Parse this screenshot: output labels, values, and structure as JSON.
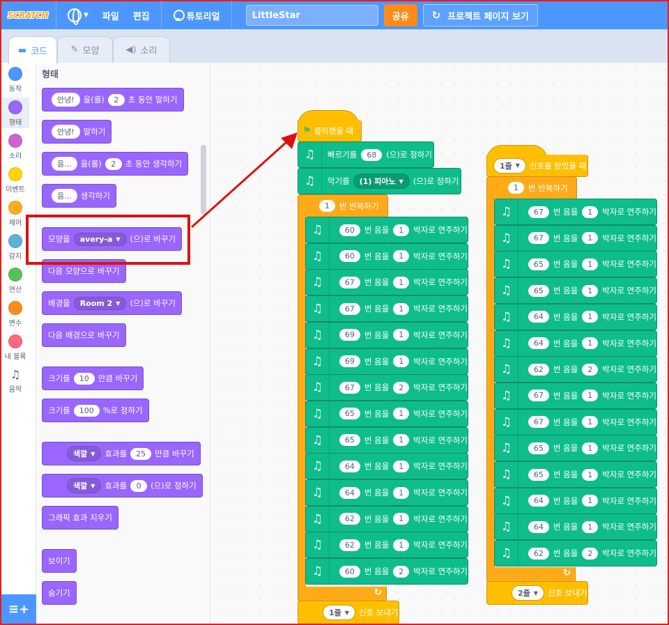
{
  "menu": {
    "logo": "SCRATCH",
    "file": "파일",
    "edit": "편집",
    "tutorials": "튜토리얼",
    "project_title": "LittleStar",
    "share": "공유",
    "see_project_page": "프로젝트 페이지 보기"
  },
  "tabs": {
    "code": "코드",
    "costumes": "모양",
    "sounds": "소리"
  },
  "categories": [
    {
      "label": "동작",
      "color": "#4c97ff"
    },
    {
      "label": "형태",
      "color": "#9966ff"
    },
    {
      "label": "소리",
      "color": "#cf63cf"
    },
    {
      "label": "이벤트",
      "color": "#ffd500"
    },
    {
      "label": "제어",
      "color": "#ffab19"
    },
    {
      "label": "감지",
      "color": "#5cb1d6"
    },
    {
      "label": "연산",
      "color": "#59c059"
    },
    {
      "label": "변수",
      "color": "#ff8c1a"
    },
    {
      "label": "내 블록",
      "color": "#ff6680"
    },
    {
      "label": "음악",
      "color": ""
    }
  ],
  "palette": {
    "heading": "형태",
    "say_for": {
      "a": "안녕!",
      "b": "을(를)",
      "c": "2",
      "d": "초 동안 말하기"
    },
    "say": {
      "a": "안녕!",
      "b": "말하기"
    },
    "think_for": {
      "a": "음...",
      "b": "을(를)",
      "c": "2",
      "d": "초 동안 생각하기"
    },
    "think": {
      "a": "음...",
      "b": "생각하기"
    },
    "switch_costume": {
      "a": "모양을",
      "b": "avery-a",
      "c": "(으)로 바꾸기"
    },
    "next_costume": "다음 모양으로 바꾸기",
    "switch_backdrop": {
      "a": "배경을",
      "b": "Room 2",
      "c": "(으)로 바꾸기"
    },
    "next_backdrop": "다음 배경으로 바꾸기",
    "change_size": {
      "a": "크기를",
      "b": "10",
      "c": "만큼 바꾸기"
    },
    "set_size": {
      "a": "크기를",
      "b": "100",
      "c": "%로 정하기"
    },
    "change_effect": {
      "a": "색깔",
      "b": "효과를",
      "c": "25",
      "d": "만큼 바꾸기"
    },
    "set_effect": {
      "a": "색깔",
      "b": "효과를",
      "c": "0",
      "d": "(으)로 정하기"
    },
    "clear_effects": "그래픽 효과 지우기",
    "show": "보이기",
    "hide": "숨기기"
  },
  "script1": {
    "hat": "클릭했을 때",
    "tempo": {
      "a": "빠르기를",
      "b": "68",
      "c": "(으)로 정하기"
    },
    "instrument": {
      "a": "악기를",
      "b": "(1) 피아노",
      "c": "(으)로 정하기"
    },
    "repeat": {
      "a": "1",
      "b": "번 반복하기"
    },
    "notes": [
      {
        "note": "60",
        "beats": "1"
      },
      {
        "note": "60",
        "beats": "1"
      },
      {
        "note": "67",
        "beats": "1"
      },
      {
        "note": "67",
        "beats": "1"
      },
      {
        "note": "69",
        "beats": "1"
      },
      {
        "note": "69",
        "beats": "1"
      },
      {
        "note": "67",
        "beats": "2"
      },
      {
        "note": "65",
        "beats": "1"
      },
      {
        "note": "65",
        "beats": "1"
      },
      {
        "note": "64",
        "beats": "1"
      },
      {
        "note": "64",
        "beats": "1"
      },
      {
        "note": "62",
        "beats": "1"
      },
      {
        "note": "62",
        "beats": "1"
      },
      {
        "note": "60",
        "beats": "2"
      }
    ],
    "broadcast": {
      "a": "1줄",
      "b": "신호 보내기"
    }
  },
  "script2": {
    "hat": {
      "a": "1줄",
      "b": "신호를 받았을 때"
    },
    "repeat": {
      "a": "1",
      "b": "번 반복하기"
    },
    "notes": [
      {
        "note": "67",
        "beats": "1"
      },
      {
        "note": "67",
        "beats": "1"
      },
      {
        "note": "65",
        "beats": "1"
      },
      {
        "note": "65",
        "beats": "1"
      },
      {
        "note": "64",
        "beats": "1"
      },
      {
        "note": "64",
        "beats": "1"
      },
      {
        "note": "62",
        "beats": "2"
      },
      {
        "note": "67",
        "beats": "1"
      },
      {
        "note": "67",
        "beats": "1"
      },
      {
        "note": "65",
        "beats": "1"
      },
      {
        "note": "65",
        "beats": "1"
      },
      {
        "note": "64",
        "beats": "1"
      },
      {
        "note": "64",
        "beats": "1"
      },
      {
        "note": "62",
        "beats": "2"
      }
    ],
    "broadcast": {
      "a": "2줄",
      "b": "신호 보내기"
    }
  },
  "note_labels": {
    "pre": "번 음을",
    "post": "박자로 연주하기"
  },
  "colors": {
    "menu": "#4c97ff",
    "looks": "#9966ff",
    "music": "#0fbd8c",
    "control": "#ffab19",
    "events": "#ffbf00",
    "annotation": "#e01010"
  }
}
